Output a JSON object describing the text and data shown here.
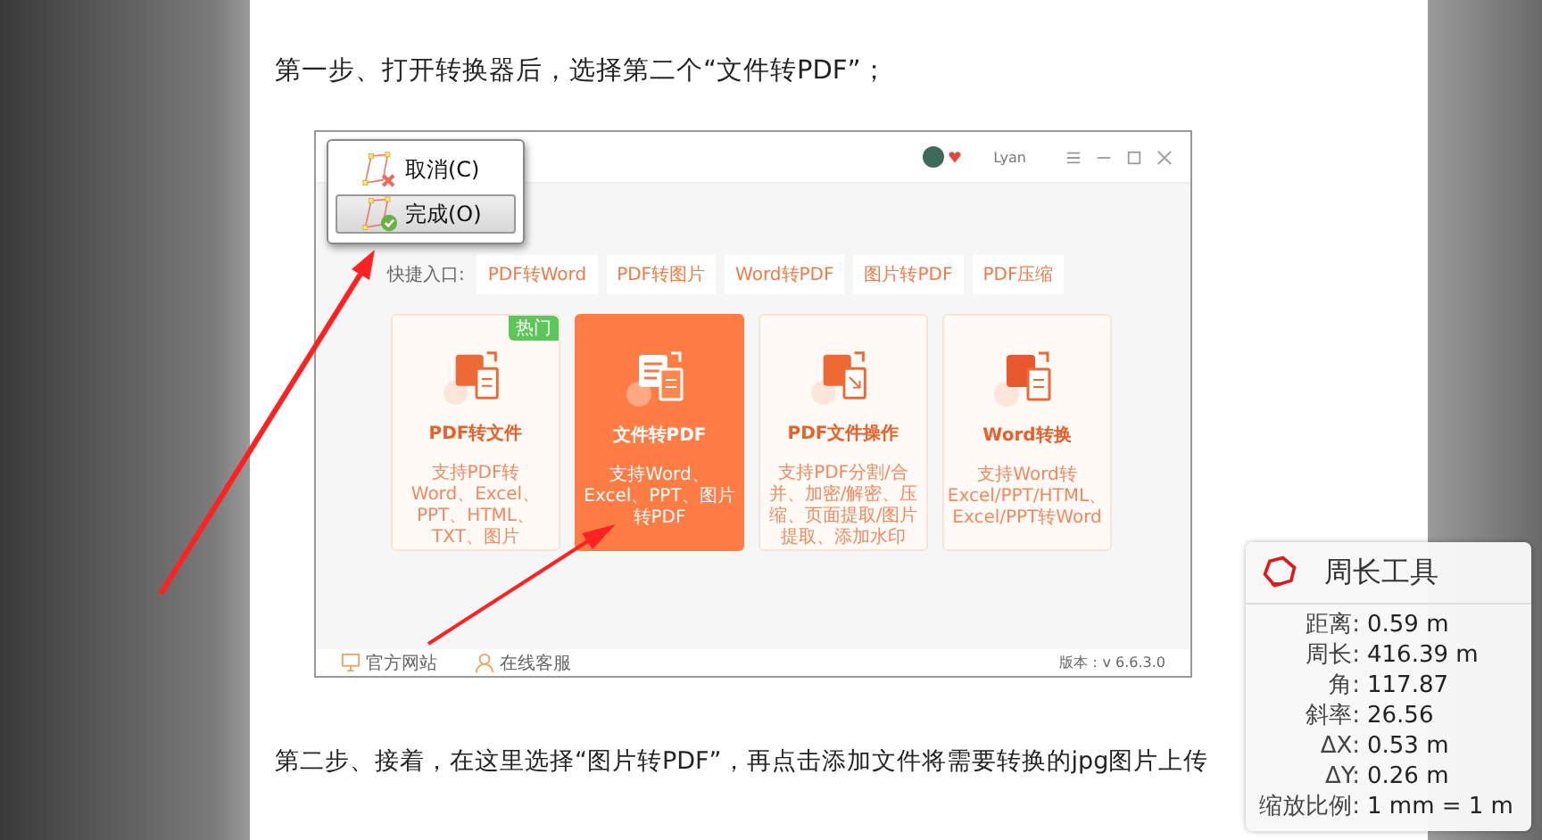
{
  "document": {
    "paragraphs": [
      "第一步、打开转换器后，选择第二个“文件转PDF”；",
      "第二步、接着，在这里选择“图片转PDF”，再点击添加文件将需要转换的jpg图片上传"
    ]
  },
  "app_screenshot": {
    "user": "Lyan",
    "quick_entry": {
      "label": "快捷入口:",
      "chips": [
        "PDF转Word",
        "PDF转图片",
        "Word转PDF",
        "图片转PDF",
        "PDF压缩"
      ]
    },
    "cards": [
      {
        "kind": "pdf",
        "title": "PDF转文件",
        "description": "支持PDF转Word、Excel、PPT、HTML、TXT、图片",
        "badge": "热门",
        "selected": false
      },
      {
        "kind": "file",
        "title": "文件转PDF",
        "description": "支持Word、Excel、PPT、图片转PDF",
        "selected": true
      },
      {
        "kind": "edit",
        "title": "PDF文件操作",
        "description": "支持PDF分割/合并、加密/解密、压缩、页面提取/图片提取、添加水印",
        "selected": false
      },
      {
        "kind": "word",
        "title": "Word转换",
        "description": "支持Word转Excel/PPT/HTML、Excel/PPT转Word",
        "selected": false
      }
    ],
    "footer": {
      "links": [
        {
          "kind": "site",
          "label": "官方网站"
        },
        {
          "kind": "service",
          "label": "在线客服"
        }
      ],
      "version": "版本：v 6.6.3.0"
    }
  },
  "context_menu": {
    "items": [
      {
        "kind": "cancel",
        "label": "取消(C)",
        "selected": false
      },
      {
        "kind": "done",
        "label": "完成(O)",
        "selected": true
      }
    ]
  },
  "measure_panel": {
    "title": "周长工具",
    "rows": [
      {
        "label": "距离:",
        "value": "0.59 m"
      },
      {
        "label": "周长:",
        "value": "416.39 m"
      },
      {
        "label": "角:",
        "value": "117.87"
      },
      {
        "label": "斜率:",
        "value": "26.56"
      },
      {
        "label": "ΔX:",
        "value": "0.53 m"
      },
      {
        "label": "ΔY:",
        "value": "0.26 m"
      },
      {
        "label": "缩放比例:",
        "value": "1 mm = 1 m"
      }
    ]
  }
}
